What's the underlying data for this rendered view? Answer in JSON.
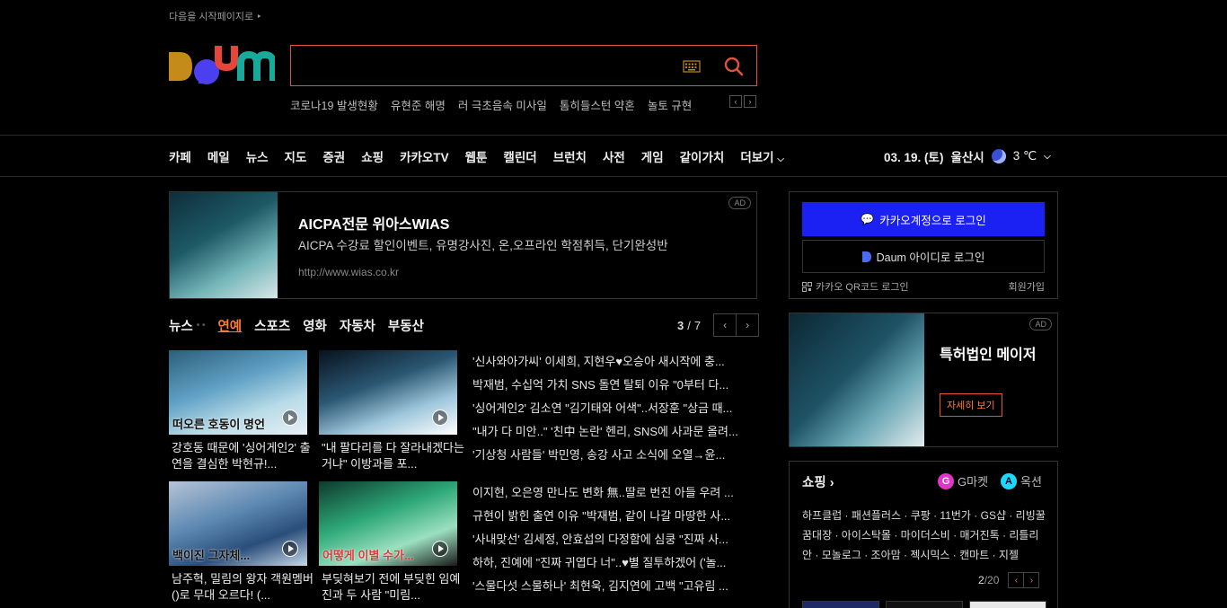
{
  "header": {
    "set_homepage": "다음을 시작페이지로",
    "logo_text": "Daum",
    "search_placeholder": "",
    "trending": [
      "코로나19 발생현황",
      "유현준 해명",
      "러 극초음속 미사일",
      "톰히들스턴 약혼",
      "놀토 규현"
    ]
  },
  "gnb": {
    "items": [
      "카페",
      "메일",
      "뉴스",
      "지도",
      "증권",
      "쇼핑",
      "카카오TV",
      "웹툰",
      "캘린더",
      "브런치",
      "사전",
      "게임",
      "같이가치",
      "더보기"
    ]
  },
  "weather": {
    "date": "03. 19. (토)",
    "city": "울산시",
    "temp": "3 ℃"
  },
  "ad_top": {
    "badge": "AD",
    "title": "AICPA전문 위아스WIAS",
    "desc": "AICPA 수강료 할인이벤트, 유명강사진, 온,오프라인 학점취득, 단기완성반",
    "url": "http://www.wias.co.kr"
  },
  "news": {
    "tabs": [
      "뉴스",
      "연예",
      "스포츠",
      "영화",
      "자동차",
      "부동산"
    ],
    "page_current": "3",
    "page_sep": "/",
    "page_total": "7",
    "thumbs": [
      {
        "overlay": "떠오른 호동이 명언",
        "caption": "강호동 때문에 '싱어게인2' 출연을 결심한 박현규!..."
      },
      {
        "overlay": "",
        "caption": "\"내 팔다리를 다 잘라내겠다는 거냐\" 이방과를 포..."
      },
      {
        "overlay": "백이진 그자체...",
        "caption": "남주혁, 밀림의 왕자 객원멤버()로 무대 오르다! (..."
      },
      {
        "overlay": "어떻게 이별 수가...",
        "caption": "부딪혀보기 전에 부딪힌 임예진과 두 사람 \"미림..."
      }
    ],
    "headlines_a": [
      "'신사와아가씨' 이세희, 지현우♥오승아 새시작에 충...",
      "박재범, 수십억 가치 SNS 돌연 탈퇴 이유 \"0부터 다...",
      "'싱어게인2' 김소연 \"김기태와 어색\"..서장훈 \"상금 때...",
      "\"내가 다 미안..\" '친中 논란' 헨리, SNS에 사과문 올려...",
      "'기상청 사람들' 박민영, 송강 사고 소식에 오열→윤..."
    ],
    "headlines_b": [
      "이지현, 오은영 만나도 변화 無..딸로 번진 아들 우려 ...",
      "규현이 밝힌 출연 이유 \"박재범, 같이 나갈 마땅한 사...",
      "'사내맞선' 김세정, 안효섭의 다정함에 심쿵 \"진짜 사...",
      "하하, 진예에 \"진짜 귀엽다 너\"..♥별 질투하겠어 ('놀...",
      "'스물다섯 스물하나' 최현욱, 김지연에 고백 \"고유림 ..."
    ]
  },
  "login": {
    "kakao": "카카오계정으로 로그인",
    "daum": "Daum 아이디로 로그인",
    "qr": "카카오 QR코드 로그인",
    "join": "회원가입"
  },
  "ad_side": {
    "badge": "AD",
    "title": "특허법인 메이저",
    "button": "자세히 보기"
  },
  "shopping": {
    "title": "쇼핑",
    "gmarket": "G마켓",
    "auction": "옥션",
    "links_text": "하프클럽 · 패션플러스 · 쿠팡 · 11번가 · GS샵 · 리빙꿀꿈대장 · 아이스탁몰 · 마이더스비 · 매거진톡 · 리틀리안 · 모놀로그 · 조아맘 · 젝시믹스 · 캔마트 · 지젤",
    "page_current": "2",
    "page_total": "/20"
  },
  "colors": {
    "accent": "#ff7a3d",
    "kakao_blue": "#1a21f2",
    "border_search": "#e0533a"
  }
}
